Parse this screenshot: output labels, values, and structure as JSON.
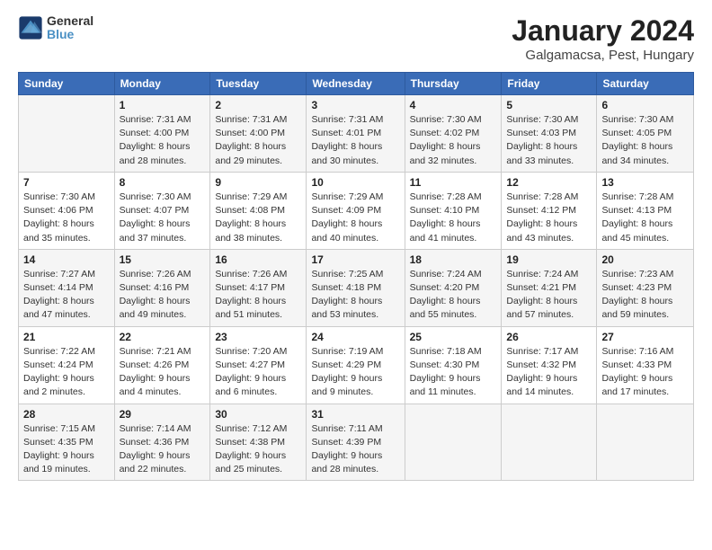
{
  "header": {
    "title": "January 2024",
    "subtitle": "Galgamacsa, Pest, Hungary",
    "logo_general": "General",
    "logo_blue": "Blue"
  },
  "days_of_week": [
    "Sunday",
    "Monday",
    "Tuesday",
    "Wednesday",
    "Thursday",
    "Friday",
    "Saturday"
  ],
  "weeks": [
    [
      {
        "day": null,
        "info": null
      },
      {
        "day": "1",
        "sunrise": "7:31 AM",
        "sunset": "4:00 PM",
        "daylight": "8 hours and 28 minutes."
      },
      {
        "day": "2",
        "sunrise": "7:31 AM",
        "sunset": "4:00 PM",
        "daylight": "8 hours and 29 minutes."
      },
      {
        "day": "3",
        "sunrise": "7:31 AM",
        "sunset": "4:01 PM",
        "daylight": "8 hours and 30 minutes."
      },
      {
        "day": "4",
        "sunrise": "7:30 AM",
        "sunset": "4:02 PM",
        "daylight": "8 hours and 32 minutes."
      },
      {
        "day": "5",
        "sunrise": "7:30 AM",
        "sunset": "4:03 PM",
        "daylight": "8 hours and 33 minutes."
      },
      {
        "day": "6",
        "sunrise": "7:30 AM",
        "sunset": "4:05 PM",
        "daylight": "8 hours and 34 minutes."
      }
    ],
    [
      {
        "day": "7",
        "sunrise": "7:30 AM",
        "sunset": "4:06 PM",
        "daylight": "8 hours and 35 minutes."
      },
      {
        "day": "8",
        "sunrise": "7:30 AM",
        "sunset": "4:07 PM",
        "daylight": "8 hours and 37 minutes."
      },
      {
        "day": "9",
        "sunrise": "7:29 AM",
        "sunset": "4:08 PM",
        "daylight": "8 hours and 38 minutes."
      },
      {
        "day": "10",
        "sunrise": "7:29 AM",
        "sunset": "4:09 PM",
        "daylight": "8 hours and 40 minutes."
      },
      {
        "day": "11",
        "sunrise": "7:28 AM",
        "sunset": "4:10 PM",
        "daylight": "8 hours and 41 minutes."
      },
      {
        "day": "12",
        "sunrise": "7:28 AM",
        "sunset": "4:12 PM",
        "daylight": "8 hours and 43 minutes."
      },
      {
        "day": "13",
        "sunrise": "7:28 AM",
        "sunset": "4:13 PM",
        "daylight": "8 hours and 45 minutes."
      }
    ],
    [
      {
        "day": "14",
        "sunrise": "7:27 AM",
        "sunset": "4:14 PM",
        "daylight": "8 hours and 47 minutes."
      },
      {
        "day": "15",
        "sunrise": "7:26 AM",
        "sunset": "4:16 PM",
        "daylight": "8 hours and 49 minutes."
      },
      {
        "day": "16",
        "sunrise": "7:26 AM",
        "sunset": "4:17 PM",
        "daylight": "8 hours and 51 minutes."
      },
      {
        "day": "17",
        "sunrise": "7:25 AM",
        "sunset": "4:18 PM",
        "daylight": "8 hours and 53 minutes."
      },
      {
        "day": "18",
        "sunrise": "7:24 AM",
        "sunset": "4:20 PM",
        "daylight": "8 hours and 55 minutes."
      },
      {
        "day": "19",
        "sunrise": "7:24 AM",
        "sunset": "4:21 PM",
        "daylight": "8 hours and 57 minutes."
      },
      {
        "day": "20",
        "sunrise": "7:23 AM",
        "sunset": "4:23 PM",
        "daylight": "8 hours and 59 minutes."
      }
    ],
    [
      {
        "day": "21",
        "sunrise": "7:22 AM",
        "sunset": "4:24 PM",
        "daylight": "9 hours and 2 minutes."
      },
      {
        "day": "22",
        "sunrise": "7:21 AM",
        "sunset": "4:26 PM",
        "daylight": "9 hours and 4 minutes."
      },
      {
        "day": "23",
        "sunrise": "7:20 AM",
        "sunset": "4:27 PM",
        "daylight": "9 hours and 6 minutes."
      },
      {
        "day": "24",
        "sunrise": "7:19 AM",
        "sunset": "4:29 PM",
        "daylight": "9 hours and 9 minutes."
      },
      {
        "day": "25",
        "sunrise": "7:18 AM",
        "sunset": "4:30 PM",
        "daylight": "9 hours and 11 minutes."
      },
      {
        "day": "26",
        "sunrise": "7:17 AM",
        "sunset": "4:32 PM",
        "daylight": "9 hours and 14 minutes."
      },
      {
        "day": "27",
        "sunrise": "7:16 AM",
        "sunset": "4:33 PM",
        "daylight": "9 hours and 17 minutes."
      }
    ],
    [
      {
        "day": "28",
        "sunrise": "7:15 AM",
        "sunset": "4:35 PM",
        "daylight": "9 hours and 19 minutes."
      },
      {
        "day": "29",
        "sunrise": "7:14 AM",
        "sunset": "4:36 PM",
        "daylight": "9 hours and 22 minutes."
      },
      {
        "day": "30",
        "sunrise": "7:12 AM",
        "sunset": "4:38 PM",
        "daylight": "9 hours and 25 minutes."
      },
      {
        "day": "31",
        "sunrise": "7:11 AM",
        "sunset": "4:39 PM",
        "daylight": "9 hours and 28 minutes."
      },
      {
        "day": null,
        "info": null
      },
      {
        "day": null,
        "info": null
      },
      {
        "day": null,
        "info": null
      }
    ]
  ],
  "labels": {
    "sunrise_prefix": "Sunrise: ",
    "sunset_prefix": "Sunset: ",
    "daylight_prefix": "Daylight: "
  }
}
